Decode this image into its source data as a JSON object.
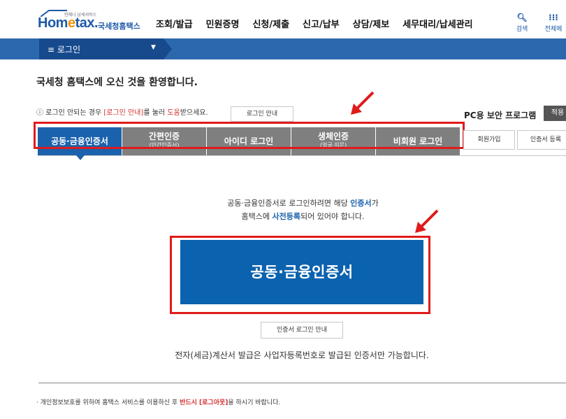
{
  "header": {
    "logo_tag": "언제나 납세서비스",
    "logo_home_a": "Hom",
    "logo_home_e": "e",
    "logo_home_b": "tax.",
    "logo_kor": "국세청홈택스",
    "menu": [
      "조회/발급",
      "민원증명",
      "신청/제출",
      "신고/납부",
      "상담/제보",
      "세무대리/납세관리"
    ],
    "search_label": "검색",
    "allmenu_label": "전체메"
  },
  "bluebar": {
    "label": "≡ 로그인",
    "dropdown": "▼"
  },
  "welcome": "국세청 홈택스에 오신 것을 환영합니다.",
  "notice": {
    "icon": "ⓘ",
    "pre": "로그인 안되는 경우 ",
    "red1": "[로그인 안내]",
    "mid": "를 눌러 ",
    "red2": "도움",
    "post": "받으세요."
  },
  "login_guide_button": "로그인 안내",
  "pc_security": "PC용 보안 프로그램",
  "install_button": "적용",
  "tabs": [
    {
      "label": "공동·금융인증서",
      "sub": ""
    },
    {
      "label": "간편인증",
      "sub": "(민간인증서)"
    },
    {
      "label": "아이디 로그인",
      "sub": ""
    },
    {
      "label": "생체인증",
      "sub": "(얼굴·지문)"
    },
    {
      "label": "비회원 로그인",
      "sub": ""
    }
  ],
  "join_button": "회원가입",
  "cert_register_button": "인증서 등록",
  "info": {
    "l1a": "공동·금융인증서로 로그인하려면 해당 ",
    "l1b": "인증서",
    "l1c": "가",
    "l2a": "홈택스에 ",
    "l2b": "사전등록",
    "l2c": "되어 있어야 합니다."
  },
  "main_button": "공동·금융인증서",
  "cert_guide_button": "인증서 로그인 안내",
  "tax_note": "전자(세금)계산서 발급은 사업자등록번호로 발급된 인증서만 가능합니다.",
  "privacy": {
    "pre": "· 개인정보보호를 위하여 홈택스 서비스를 이용하신 후 ",
    "red": "반드시 [로그아웃]",
    "post": "을 하시기 바랍니다."
  },
  "colors": {
    "brand_blue": "#1b62ad",
    "highlight_red": "#e01b1b",
    "tab_gray": "#7f7f7f"
  }
}
